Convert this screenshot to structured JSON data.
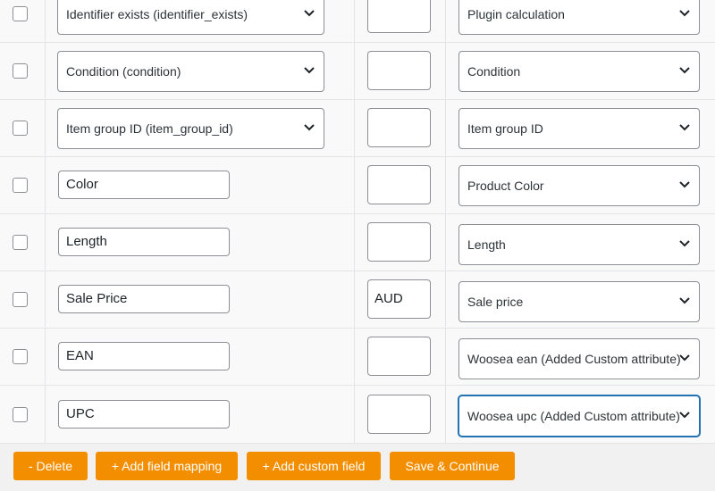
{
  "rows": [
    {
      "type": "select",
      "attribute": "Identifier exists (identifier_exists)",
      "prefix": "",
      "value": "Plugin calculation"
    },
    {
      "type": "select",
      "attribute": "Condition (condition)",
      "prefix": "",
      "value": "Condition"
    },
    {
      "type": "select",
      "attribute": "Item group ID (item_group_id)",
      "prefix": "",
      "value": "Item group ID"
    },
    {
      "type": "text",
      "attribute": "Color",
      "prefix": "",
      "value": "Product Color"
    },
    {
      "type": "text",
      "attribute": "Length",
      "prefix": "",
      "value": "Length"
    },
    {
      "type": "text",
      "attribute": "Sale Price",
      "prefix": "AUD",
      "value": "Sale price"
    },
    {
      "type": "text",
      "attribute": "EAN",
      "prefix": "",
      "value": "Woosea ean (Added Custom attribute)"
    },
    {
      "type": "text",
      "attribute": "UPC",
      "prefix": "",
      "value": "Woosea upc (Added Custom attribute)"
    }
  ],
  "buttons": {
    "delete": "- Delete",
    "add_mapping": "+ Add field mapping",
    "add_custom": "+ Add custom field",
    "save": "Save & Continue"
  },
  "colors": {
    "button": "#f38e00",
    "focus": "#2271b1"
  },
  "icons": {
    "dropdown": "chevron-down-icon"
  }
}
